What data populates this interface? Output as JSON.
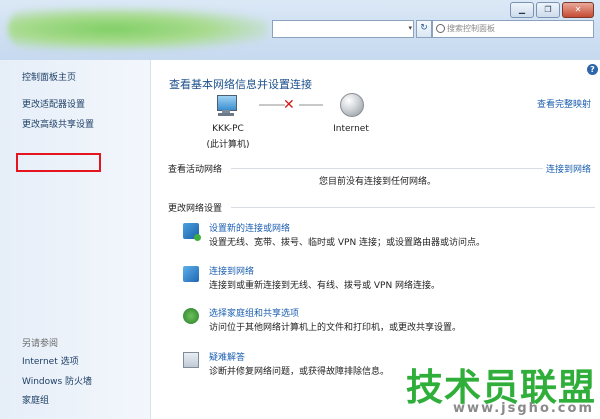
{
  "window": {
    "controls": {
      "minimize": "▁",
      "maximize": "❐",
      "close": "✕"
    }
  },
  "address": {
    "dropdown": "▾",
    "refresh": "↻"
  },
  "search": {
    "placeholder": "搜索控制面板"
  },
  "sidebar": {
    "items": [
      {
        "label": "控制面板主页"
      },
      {
        "label": "更改适配器设置",
        "highlighted": true
      },
      {
        "label": "更改高级共享设置"
      }
    ],
    "see_also_title": "另请参阅",
    "see_also": [
      {
        "label": "Internet 选项"
      },
      {
        "label": "Windows 防火墙"
      },
      {
        "label": "家庭组"
      }
    ]
  },
  "main": {
    "help": "?",
    "title": "查看基本网络信息并设置连接",
    "full_map": "查看完整映射",
    "map": {
      "computer_name": "KKK-PC",
      "computer_sub": "(此计算机)",
      "internet": "Internet",
      "status_mark": "✕"
    },
    "active_label": "查看活动网络",
    "connect_link": "连接到网络",
    "no_network": "您目前没有连接到任何网络。",
    "change_label": "更改网络设置",
    "tasks": [
      {
        "link": "设置新的连接或网络",
        "desc": "设置无线、宽带、拨号、临时或 VPN 连接；或设置路由器或访问点。"
      },
      {
        "link": "连接到网络",
        "desc": "连接到或重新连接到无线、有线、拨号或 VPN 网络连接。"
      },
      {
        "link": "选择家庭组和共享选项",
        "desc": "访问位于其他网络计算机上的文件和打印机，或更改共享设置。"
      },
      {
        "link": "疑难解答",
        "desc": "诊断并修复网络问题，或获得故障排除信息。"
      }
    ]
  },
  "watermark": {
    "brand": "技术员联盟",
    "url": "www.jsgho.com"
  },
  "colors": {
    "link": "#1c5fb0",
    "highlight_box": "#e4151e",
    "watermark": "#2fae3a"
  }
}
